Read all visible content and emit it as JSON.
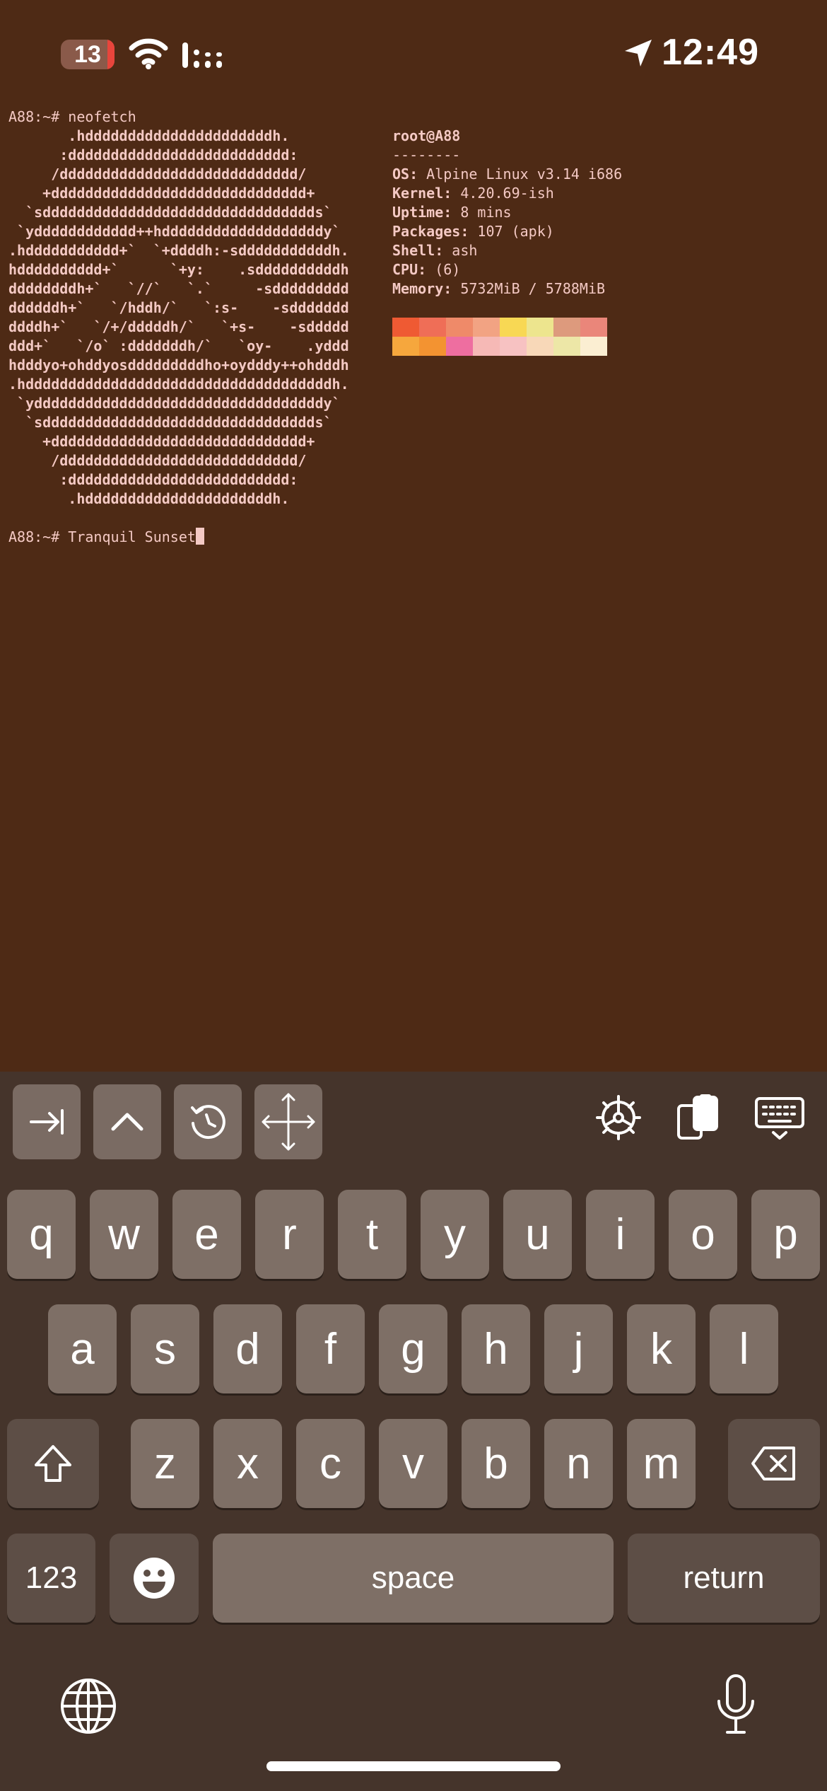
{
  "status_bar": {
    "battery_level": "13",
    "time": "12:49"
  },
  "terminal": {
    "prompt_1": "A88:~# neofetch",
    "ascii_logo": "       .hddddddddddddddddddddddh.\n      :dddddddddddddddddddddddddd:\n     /dddddddddddddddddddddddddddd/\n    +dddddddddddddddddddddddddddddd+\n  `sdddddddddddddddddddddddddddddddds`\n `ydddddddddddd++hdddddddddddddddddddy`\n.hddddddddddd+`  `+ddddh:-sdddddddddddh.\nhdddddddddd+`      `+y:    .sddddddddddh\nddddddddh+`   `//`   `.`     -sddddddddd\nddddddh+`   `/hddh/`   `:s-    -sddddddd\nddddh+`   `/+/dddddh/`   `+s-    -sddddd\nddd+`   `/o` :dddddddh/`   `oy-    .yddd\nhdddyo+ohddyosdddddddddho+oydddy++ohdddh\n.hddddddddddddddddddddddddddddddddddddh.\n `yddddddddddddddddddddddddddddddddddy`\n  `sdddddddddddddddddddddddddddddddds`\n    +dddddddddddddddddddddddddddddd+\n     /dddddddddddddddddddddddddddd/\n      :dddddddddddddddddddddddddd:\n       .hddddddddddddddddddddddh.",
    "user_host": "root@A88",
    "separator": "--------",
    "info": [
      {
        "key": "OS:",
        "value": " Alpine Linux v3.14 i686"
      },
      {
        "key": "Kernel:",
        "value": " 4.20.69-ish"
      },
      {
        "key": "Uptime:",
        "value": " 8 mins"
      },
      {
        "key": "Packages:",
        "value": " 107 (apk)"
      },
      {
        "key": "Shell:",
        "value": " ash"
      },
      {
        "key": "CPU:",
        "value": " (6)"
      },
      {
        "key": "Memory:",
        "value": " 5732MiB / 5788MiB"
      }
    ],
    "palette_row_1": [
      "#ef5a33",
      "#ef6e57",
      "#ef8a69",
      "#f2a383",
      "#f8d854",
      "#ede58e",
      "#dd9a7d",
      "#ea867a"
    ],
    "palette_row_2": [
      "#f6a73d",
      "#f39331",
      "#ee6ea0",
      "#f6b9b6",
      "#f7c2c2",
      "#f8d8b8",
      "#ede7a7",
      "#fbeed2"
    ],
    "prompt_2": "A88:~# Tranquil Sunset"
  },
  "keyboard": {
    "row1": [
      "q",
      "w",
      "e",
      "r",
      "t",
      "y",
      "u",
      "i",
      "o",
      "p"
    ],
    "row2": [
      "a",
      "s",
      "d",
      "f",
      "g",
      "h",
      "j",
      "k",
      "l"
    ],
    "row3": [
      "z",
      "x",
      "c",
      "v",
      "b",
      "n",
      "m"
    ],
    "numbers_label": "123",
    "space_label": "space",
    "return_label": "return"
  },
  "colors": {
    "background": "#4e2a15",
    "terminal_text": "#f4c9c4",
    "keyboard_bg": "#45342b",
    "key_bg": "#7e6f66",
    "key_dark_bg": "#5d4e46"
  }
}
